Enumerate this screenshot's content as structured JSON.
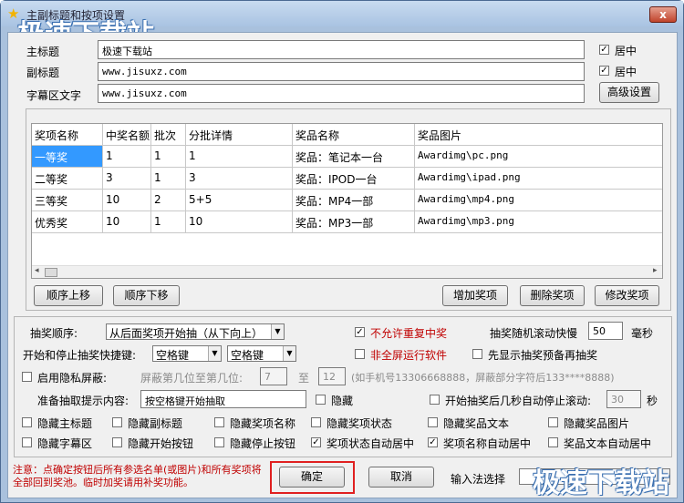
{
  "window": {
    "title": "主副标题和按项设置",
    "close_label": "x"
  },
  "watermark": "极速下载站",
  "titles": {
    "main_label": "主标题",
    "main_value": "极速下载站",
    "main_center_label": "居中",
    "sub_label": "副标题",
    "sub_value": "www.jisuxz.com",
    "sub_center_label": "居中",
    "marquee_label": "字幕区文字",
    "marquee_value": "www.jisuxz.com",
    "advanced_button": "高级设置"
  },
  "prizes": {
    "columns": [
      "奖项名称",
      "中奖名额",
      "批次",
      "分批详情",
      "奖品名称",
      "奖品图片"
    ],
    "rows": [
      [
        "一等奖",
        "1",
        "1",
        "1",
        "奖品：笔记本一台",
        "Awardimg\\pc.png"
      ],
      [
        "二等奖",
        "3",
        "1",
        "3",
        "奖品：IPOD一台",
        "Awardimg\\ipad.png"
      ],
      [
        "三等奖",
        "10",
        "2",
        "5+5",
        "奖品：MP4一部",
        "Awardimg\\mp4.png"
      ],
      [
        "优秀奖",
        "10",
        "1",
        "10",
        "奖品：MP3一部",
        "Awardimg\\mp3.png"
      ]
    ],
    "scroll_left": "◂",
    "scroll_right": "▸"
  },
  "actions": {
    "move_up": "顺序上移",
    "move_down": "顺序下移",
    "add": "增加奖项",
    "delete": "删除奖项",
    "modify": "修改奖项"
  },
  "options": {
    "order_label": "抽奖顺序:",
    "order_value": "从后面奖项开始抽（从下向上）",
    "no_repeat_label": "不允许重复中奖",
    "scroll_speed_label": "抽奖随机滚动快慢",
    "scroll_speed_value": "50",
    "scroll_speed_unit": "毫秒",
    "hotkey_label": "开始和停止抽奖快捷键:",
    "hotkey_start": "空格键",
    "hotkey_stop": "空格键",
    "not_fullscreen_label": "非全屏运行软件",
    "show_prize_first_label": "先显示抽奖预备再抽奖",
    "privacy_label": "启用隐私屏蔽:",
    "mask_from_label": "屏蔽第几位至第几位:",
    "mask_from": "7",
    "mask_to_label": "至",
    "mask_to": "12",
    "mask_hint": "(如手机号13306668888，屏蔽部分字符后133****8888)",
    "prompt_label": "准备抽取提示内容:",
    "prompt_value": "按空格键开始抽取",
    "hide_prompt_label": "隐藏",
    "auto_stop_label": "开始抽奖后几秒自动停止滚动:",
    "auto_stop_value": "30",
    "auto_stop_unit": "秒",
    "hide_main_title": "隐藏主标题",
    "hide_sub_title": "隐藏副标题",
    "hide_prize_name": "隐藏奖项名称",
    "hide_prize_status": "隐藏奖项状态",
    "hide_prize_text": "隐藏奖品文本",
    "hide_prize_image": "隐藏奖品图片",
    "hide_marquee": "隐藏字幕区",
    "hide_start_button": "隐藏开始按钮",
    "hide_stop_button": "隐藏停止按钮",
    "status_center": "奖项状态自动居中",
    "name_center": "奖项名称自动居中",
    "text_center": "奖品文本自动居中"
  },
  "footer": {
    "note": "注意：点确定按钮后所有参选名单(或图片)和所有奖项将全部回到奖池。临时加奖请用补奖功能。",
    "ok": "确定",
    "cancel": "取消",
    "ime_label": "输入法选择"
  },
  "colors": {
    "selection": "#3399ff",
    "highlight_box": "#e02020",
    "note_text": "#c00000"
  }
}
